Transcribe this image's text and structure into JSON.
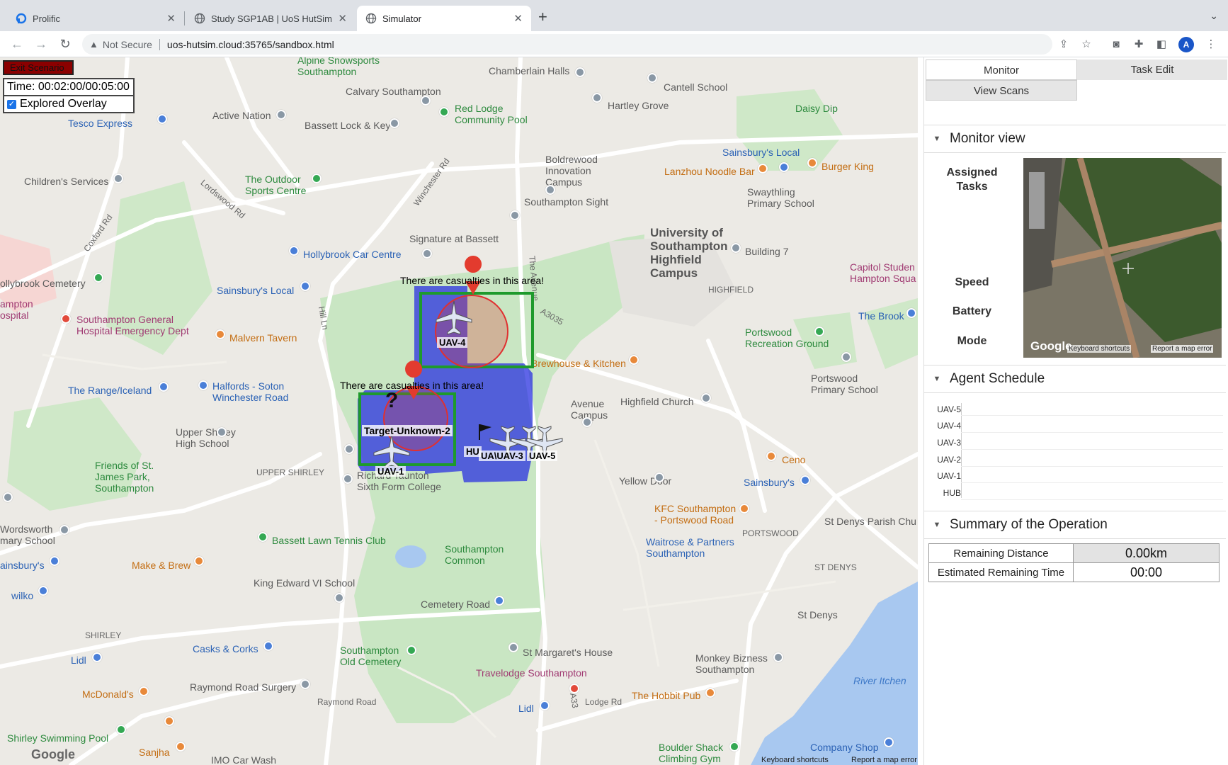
{
  "browser": {
    "tabs": [
      {
        "title": "Prolific",
        "favicon": "prolific-icon"
      },
      {
        "title": "Study SGP1AB | UoS HutSim",
        "favicon": "globe-icon"
      },
      {
        "title": "Simulator",
        "favicon": "globe-icon",
        "active": true
      }
    ],
    "new_tab": "+",
    "security": "Not Secure",
    "url": "uos-hutsim.cloud:35765/sandbox.html",
    "profile_initial": "A"
  },
  "sim": {
    "exit_label": "Exit Scenario",
    "time": "Time: 00:02:00/00:05:00",
    "overlay_label": "Explored Overlay",
    "overlay_checked": true,
    "alert1": "There are casualties in this area!",
    "alert2": "There are casualties in this area!",
    "target_label": "Target-Unknown-2",
    "unknown_mark": "?",
    "uav_labels": {
      "uav4": "UAV-4",
      "uav1": "UAV-1",
      "uav3": "UA\\UAV-3",
      "uav5": "UAV-5",
      "hub": "HU"
    }
  },
  "map": {
    "labels": {
      "alpine": "Alpine Snowsports\nSouthampton",
      "calvary": "Calvary Southampton",
      "chamberlain_halls": "Chamberlain Halls",
      "cantell": "Cantell School",
      "hartley": "Hartley Grove",
      "tesco": "Tesco Express",
      "active_nation": "Active Nation",
      "bassett_lock": "Bassett Lock & Key",
      "red_lodge": "Red Lodge\nCommunity Pool",
      "daisy_dip": "Daisy Dip",
      "sainsburys_local_ne": "Sainsbury's Local",
      "lanzhou": "Lanzhou Noodle Bar",
      "burger_king": "Burger King",
      "childrens": "Children's Services",
      "outdoor": "The Outdoor\nSports Centre",
      "boldrewood": "Boldrewood\nInnovation\nCampus",
      "southampton_sight": "Southampton Sight",
      "swaythling": "Swaythling\nPrimary School",
      "university": "University of\nSouthampton\nHighfield\nCampus",
      "building7": "Building 7",
      "signature": "Signature at Bassett",
      "hollybrook": "Hollybrook Car Centre",
      "capitol": "Capitol Studen\nHampton Squa",
      "cemetery_w": "ollybrook Cemetery",
      "hospital_w": "ampton\nospital",
      "general_hospital": "Southampton General\nHospital Emergency Dept",
      "sainsburys_local_w": "Sainsbury's Local",
      "malvern": "Malvern Tavern",
      "highfield": "HIGHFIELD",
      "the_brook": "The Brook",
      "portswood_ground": "Portswood\nRecreation Ground",
      "brewhouse": "Brewhouse & Kitchen",
      "range": "The Range/Iceland",
      "halfords": "Halfords - Soton\nWinchester Road",
      "portswood_primary": "Portswood\nPrimary School",
      "avenue_campus": "Avenue\nCampus",
      "highfield_church": "Highfield Church",
      "upper_shirley_high": "Upper Shirley\nHigh School",
      "friends": "Friends of St.\nJames Park,\nSouthampton",
      "upper_shirley": "UPPER SHIRLEY",
      "richard_taunton": "Richard Taunton\nSixth Form College",
      "yellow_door": "Yellow Door",
      "ceno": "Ceno",
      "sainsburys_e": "Sainsbury's",
      "kfc": "KFC Southampton\n- Portswood Road",
      "portswood": "PORTSWOOD",
      "st_denys_parish": "St Denys Parish Chu",
      "wordsworth": "Wordsworth\nmary School",
      "bassett_lawn": "Bassett Lawn Tennis Club",
      "make_brew": "Make & Brew",
      "southampton_common": "Southampton\nCommon",
      "waitrose": "Waitrose & Partners\nSouthampton",
      "king_edward": "King Edward VI School",
      "ainsburys": "ainsbury's",
      "wilko": "wilko",
      "cemetery_road": "Cemetery Road",
      "st_denys_label": "ST DENYS",
      "st_denys": "St Denys",
      "shirley": "SHIRLEY",
      "casks": "Casks & Corks",
      "old_cemetery": "Southampton\nOld Cemetery",
      "st_margarets": "St Margaret's House",
      "monkey": "Monkey Bizness\nSouthampton",
      "lidl_w": "Lidl",
      "travelodge": "Travelodge Southampton",
      "river_itchen": "River Itchen",
      "mcdonalds": "McDonald's",
      "raymond_surgery": "Raymond Road Surgery",
      "hobbit": "The Hobbit Pub",
      "lodge_rd": "Lodge Rd",
      "lidl_s": "Lidl",
      "raymond_road": "Raymond Road",
      "shirley_pool": "Shirley Swimming Pool",
      "sanjha": "Sanjha",
      "imo": "IMO Car Wash",
      "boulder": "Boulder Shack\nClimbing Gym",
      "company_shop": "Company Shop",
      "winchester_rd": "Winchester Rd",
      "lordswood_rd": "Lordswood Rd",
      "coxford_rd": "Coxford Rd",
      "hill_ln": "Hill Ln",
      "the_avenue": "The Avenue",
      "a3035": "A3035",
      "a33": "A33"
    },
    "foot_shortcuts": "Keyboard shortcuts",
    "foot_report": "Report a map error",
    "google": "Google"
  },
  "panel": {
    "tabs": {
      "monitor": "Monitor",
      "task_edit": "Task Edit",
      "view_scans": "View Scans"
    },
    "monitor_view": "Monitor view",
    "fields": {
      "assigned": "Assigned\nTasks",
      "speed": "Speed",
      "battery": "Battery",
      "mode": "Mode"
    },
    "sat_google": "Google",
    "sat_shortcuts": "Keyboard shortcuts",
    "sat_report": "Report a map error",
    "agent_schedule": "Agent Schedule",
    "schedule_rows": [
      "UAV-5",
      "UAV-4",
      "UAV-3",
      "UAV-2",
      "UAV-1",
      "HUB"
    ],
    "summary": "Summary of the Operation",
    "remaining_distance_label": "Remaining Distance",
    "remaining_distance": "0.00km",
    "remaining_time_label": "Estimated Remaining Time",
    "remaining_time": "00:00"
  },
  "colors": {
    "accent": "#1a73e8",
    "exit": "#8b0000",
    "uav_area": "#2a32e0",
    "green_box": "#1e9a2c",
    "casualty": "#e03030"
  }
}
